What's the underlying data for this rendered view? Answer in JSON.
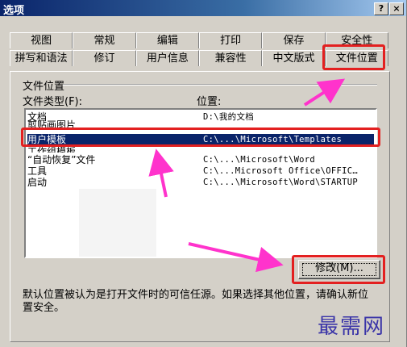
{
  "window": {
    "title": "选项",
    "help_label": "?",
    "close_label": "×"
  },
  "tabs_row1": [
    "视图",
    "常规",
    "编辑",
    "打印",
    "保存",
    "安全性"
  ],
  "tabs_row2": [
    "拼写和语法",
    "修订",
    "用户信息",
    "兼容性",
    "中文版式",
    "文件位置"
  ],
  "active_tab": "文件位置",
  "group": {
    "title": "文件位置",
    "col_type": "文件类型(F):",
    "col_location": "位置:"
  },
  "files": [
    {
      "type": "文档",
      "location": "D:\\我的文档"
    },
    {
      "type": "剪贴画图片",
      "location": ""
    },
    {
      "type": "用户模板",
      "location": "C:\\...\\Microsoft\\Templates",
      "selected": true
    },
    {
      "type": "工作组模板",
      "location": ""
    },
    {
      "type": "“自动恢复”文件",
      "location": "C:\\...\\Microsoft\\Word"
    },
    {
      "type": "工具",
      "location": "C:\\...Microsoft Office\\OFFIC…"
    },
    {
      "type": "启动",
      "location": "C:\\...\\Microsoft\\Word\\STARTUP"
    }
  ],
  "modify_button": "修改(M)...",
  "description": "默认位置被认为是打开文件时的可信任源。如果选择其他位置，请确认新位置安全。",
  "watermark": "最需网",
  "colors": {
    "selection": "#0a246a",
    "annotation_red": "#e32020",
    "annotation_arrow": "#ff33cc",
    "watermark": "#3a34a8"
  }
}
